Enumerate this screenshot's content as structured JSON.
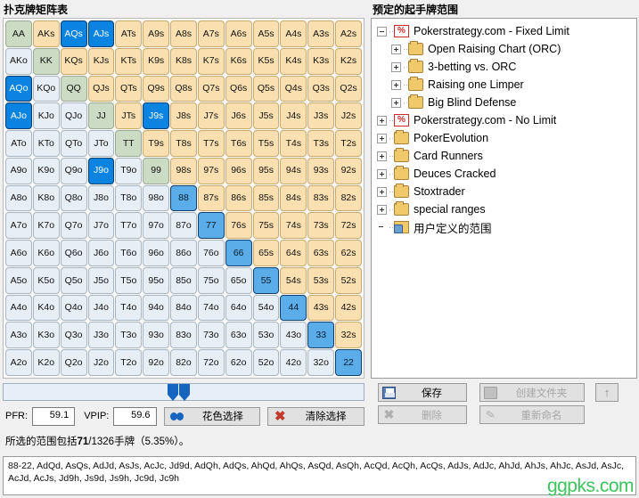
{
  "left": {
    "title": "扑克牌矩阵表",
    "matrix": {
      "ranks": [
        "A",
        "K",
        "Q",
        "J",
        "T",
        "9",
        "8",
        "7",
        "6",
        "5",
        "4",
        "3",
        "2"
      ],
      "selected": [
        "AQs",
        "AJs",
        "AQo",
        "AJo",
        "J9s",
        "J9o",
        "88",
        "77",
        "66",
        "55",
        "44",
        "33",
        "22"
      ]
    },
    "slider": {
      "left_handle": "range-min-handle",
      "right_handle": "range-max-handle"
    },
    "stats": {
      "pfr_label": "PFR:",
      "pfr_value": "59.1",
      "vpip_label": "VPIP:",
      "vpip_value": "59.6"
    },
    "buttons": {
      "suit_select": "花色选择",
      "clear_select": "清除选择"
    },
    "summary": {
      "prefix": "所选的范围包括",
      "count": "71",
      "middle": "/1326手牌（",
      "percent": "5.35%",
      "suffix": "）。"
    }
  },
  "right": {
    "title": "预定的起手牌范围",
    "tree": [
      {
        "indent": 0,
        "toggle": "minus",
        "icon": "percent-icon",
        "label": "Pokerstrategy.com - Fixed Limit"
      },
      {
        "indent": 1,
        "toggle": "plus",
        "icon": "folder-icon",
        "label": "Open Raising Chart (ORC)"
      },
      {
        "indent": 1,
        "toggle": "plus",
        "icon": "folder-icon",
        "label": "3-betting vs. ORC"
      },
      {
        "indent": 1,
        "toggle": "plus",
        "icon": "folder-icon",
        "label": "Raising one Limper"
      },
      {
        "indent": 1,
        "toggle": "plus",
        "icon": "folder-icon",
        "label": "Big Blind Defense"
      },
      {
        "indent": 0,
        "toggle": "plus",
        "icon": "percent-icon",
        "label": "Pokerstrategy.com - No Limit"
      },
      {
        "indent": 0,
        "toggle": "plus",
        "icon": "folder-icon",
        "label": "PokerEvolution"
      },
      {
        "indent": 0,
        "toggle": "plus",
        "icon": "folder-icon",
        "label": "Card Runners"
      },
      {
        "indent": 0,
        "toggle": "plus",
        "icon": "folder-icon",
        "label": "Deuces Cracked"
      },
      {
        "indent": 0,
        "toggle": "plus",
        "icon": "folder-icon",
        "label": "Stoxtrader"
      },
      {
        "indent": 0,
        "toggle": "plus",
        "icon": "folder-icon",
        "label": "special ranges"
      },
      {
        "indent": 0,
        "toggle": "none",
        "icon": "user-folder-icon",
        "label": "用户定义的范围"
      }
    ],
    "buttons": {
      "save": "保存",
      "delete": "删除",
      "new_folder": "创建文件夹",
      "rename": "重新命名",
      "up": "↑"
    }
  },
  "hand_list": "88-22, AdQd, AsQs, AdJd, AsJs, AcJc, Jd9d, AdQh, AdQs, AhQd, AhQs, AsQd, AsQh, AcQd, AcQh, AcQs, AdJs, AdJc, AhJd, AhJs, AhJc, AsJd, AsJc, AcJd, AcJs, Jd9h, Js9d, Js9h, Jc9d, Jc9h",
  "watermark": "ggpks.com",
  "colors": {
    "selected": "#0a84e0",
    "selected_pair": "#5aade8",
    "pair": "#ccdcc4",
    "suited": "#fae0b0",
    "offsuit": "#e8eef6",
    "watermark": "#3ec45c"
  }
}
